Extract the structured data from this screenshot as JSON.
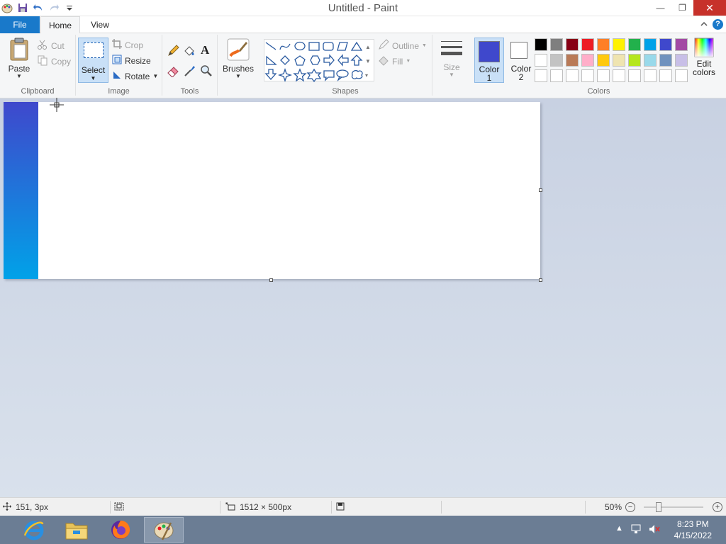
{
  "window": {
    "title": "Untitled - Paint",
    "minimize_glyph": "—",
    "maximize_glyph": "❐",
    "close_glyph": "✕"
  },
  "tabs": {
    "file": "File",
    "home": "Home",
    "view": "View"
  },
  "ribbon": {
    "clipboard": {
      "label": "Clipboard",
      "paste": "Paste",
      "cut": "Cut",
      "copy": "Copy"
    },
    "image": {
      "label": "Image",
      "select": "Select",
      "crop": "Crop",
      "resize": "Resize",
      "rotate": "Rotate"
    },
    "tools": {
      "label": "Tools",
      "text_glyph": "A"
    },
    "brushes": {
      "label": "Brushes"
    },
    "shapes": {
      "label": "Shapes",
      "outline": "Outline",
      "fill": "Fill"
    },
    "size": {
      "label": "Size"
    },
    "colors": {
      "label": "Colors",
      "color1_line1": "Color",
      "color1_line2": "1",
      "color2_line1": "Color",
      "color2_line2": "2",
      "edit_line1": "Edit",
      "edit_line2": "colors",
      "color1_value": "#3f48cc",
      "palette_row1": [
        "#000000",
        "#7f7f7f",
        "#880015",
        "#ed1c24",
        "#ff7f27",
        "#fff200",
        "#22b14c",
        "#00a2e8",
        "#3f48cc",
        "#a349a4"
      ],
      "palette_row2": [
        "#ffffff",
        "#c3c3c3",
        "#b97a57",
        "#ffaec9",
        "#ffc90e",
        "#efe4b0",
        "#b5e61d",
        "#99d9ea",
        "#7092be",
        "#c8bfe7"
      ],
      "palette_row3": [
        "#ffffff",
        "#ffffff",
        "#ffffff",
        "#ffffff",
        "#ffffff",
        "#ffffff",
        "#ffffff",
        "#ffffff",
        "#ffffff",
        "#ffffff"
      ]
    }
  },
  "canvas": {
    "gradient_top": "#3f48cc",
    "gradient_bottom": "#00a2e8"
  },
  "status": {
    "cursor_pos": "151, 3px",
    "image_size": "1512 × 500px",
    "zoom": "50%"
  },
  "taskbar": {
    "time": "8:23 PM",
    "date": "4/15/2022"
  }
}
